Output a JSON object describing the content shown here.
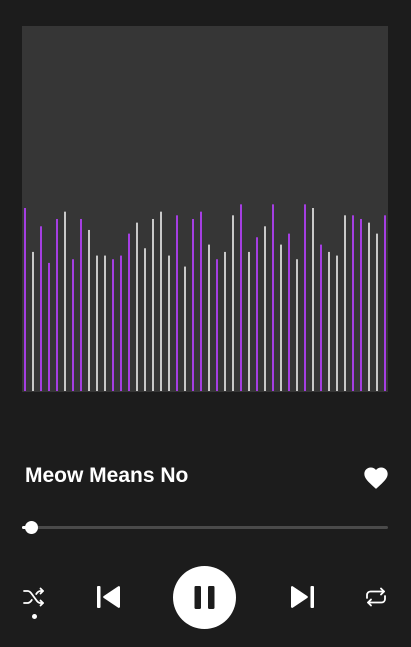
{
  "track": {
    "title": "Meow Means No",
    "liked": true
  },
  "playback": {
    "progress": 0.02,
    "state": "playing",
    "shuffle_enabled": true,
    "repeat_enabled": false
  },
  "visualizer": {
    "colors": {
      "accent": "#a53ee3",
      "neutral": "#c9c9c9"
    },
    "bars": [
      {
        "level": 0.5,
        "tone": "accent"
      },
      {
        "level": 0.38,
        "tone": "neutral"
      },
      {
        "level": 0.45,
        "tone": "accent"
      },
      {
        "level": 0.35,
        "tone": "accent"
      },
      {
        "level": 0.47,
        "tone": "accent"
      },
      {
        "level": 0.49,
        "tone": "neutral"
      },
      {
        "level": 0.36,
        "tone": "accent"
      },
      {
        "level": 0.47,
        "tone": "accent"
      },
      {
        "level": 0.44,
        "tone": "neutral"
      },
      {
        "level": 0.37,
        "tone": "neutral"
      },
      {
        "level": 0.37,
        "tone": "neutral"
      },
      {
        "level": 0.36,
        "tone": "accent"
      },
      {
        "level": 0.37,
        "tone": "accent"
      },
      {
        "level": 0.43,
        "tone": "accent"
      },
      {
        "level": 0.46,
        "tone": "neutral"
      },
      {
        "level": 0.39,
        "tone": "neutral"
      },
      {
        "level": 0.47,
        "tone": "neutral"
      },
      {
        "level": 0.49,
        "tone": "neutral"
      },
      {
        "level": 0.37,
        "tone": "neutral"
      },
      {
        "level": 0.48,
        "tone": "accent"
      },
      {
        "level": 0.34,
        "tone": "neutral"
      },
      {
        "level": 0.47,
        "tone": "accent"
      },
      {
        "level": 0.49,
        "tone": "accent"
      },
      {
        "level": 0.4,
        "tone": "neutral"
      },
      {
        "level": 0.36,
        "tone": "accent"
      },
      {
        "level": 0.38,
        "tone": "neutral"
      },
      {
        "level": 0.48,
        "tone": "neutral"
      },
      {
        "level": 0.51,
        "tone": "accent"
      },
      {
        "level": 0.38,
        "tone": "neutral"
      },
      {
        "level": 0.42,
        "tone": "accent"
      },
      {
        "level": 0.45,
        "tone": "neutral"
      },
      {
        "level": 0.51,
        "tone": "accent"
      },
      {
        "level": 0.4,
        "tone": "neutral"
      },
      {
        "level": 0.43,
        "tone": "accent"
      },
      {
        "level": 0.36,
        "tone": "neutral"
      },
      {
        "level": 0.51,
        "tone": "accent"
      },
      {
        "level": 0.5,
        "tone": "neutral"
      },
      {
        "level": 0.4,
        "tone": "accent"
      },
      {
        "level": 0.38,
        "tone": "neutral"
      },
      {
        "level": 0.37,
        "tone": "neutral"
      },
      {
        "level": 0.48,
        "tone": "neutral"
      },
      {
        "level": 0.48,
        "tone": "accent"
      },
      {
        "level": 0.47,
        "tone": "accent"
      },
      {
        "level": 0.46,
        "tone": "neutral"
      },
      {
        "level": 0.43,
        "tone": "neutral"
      },
      {
        "level": 0.48,
        "tone": "accent"
      }
    ]
  },
  "icons": {
    "like": "heart-icon",
    "shuffle": "shuffle-icon",
    "previous": "skip-previous-icon",
    "play_pause": "pause-icon",
    "next": "skip-next-icon",
    "repeat": "repeat-icon"
  }
}
